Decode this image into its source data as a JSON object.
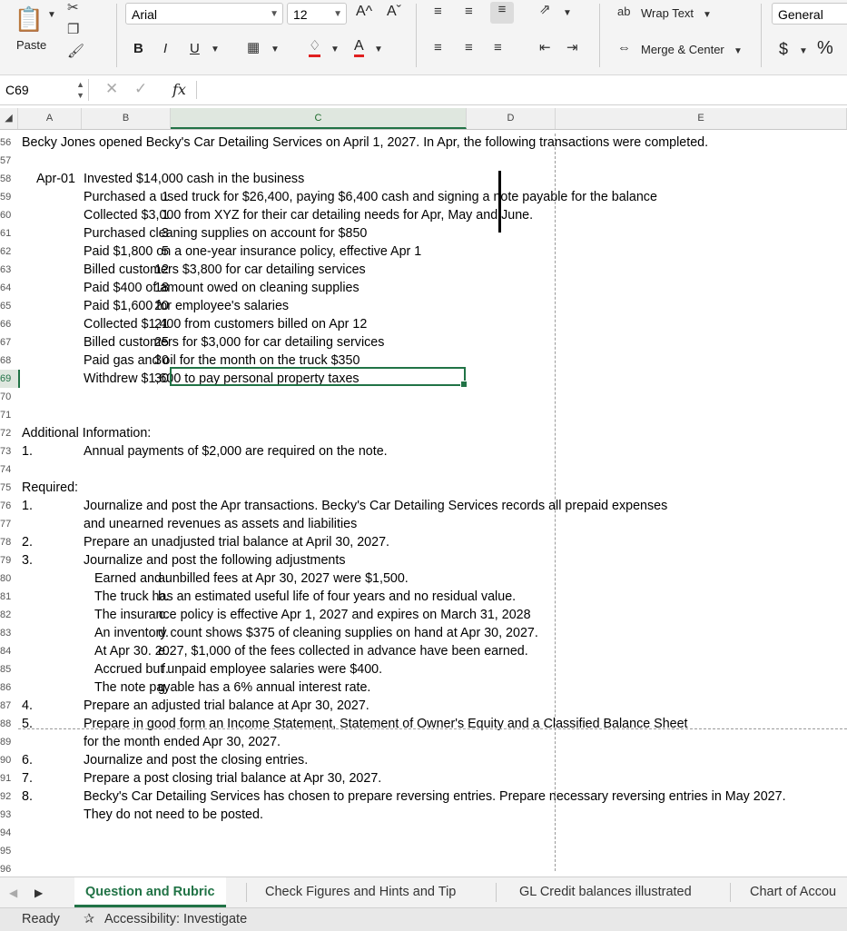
{
  "ribbon": {
    "paste_label": "Paste",
    "font_name": "Arial",
    "font_size": "12",
    "wrap_text_label": "Wrap Text",
    "merge_center_label": "Merge & Center",
    "number_format": "General",
    "currency_symbol": "$",
    "percent_symbol": "%",
    "bold": "B",
    "italic": "I",
    "underline": "U",
    "font_color_letter": "A",
    "grow_font": "A^",
    "shrink_font": "Aˇ"
  },
  "formula_bar": {
    "name_box": "C69",
    "fx": "fx",
    "value": ""
  },
  "columns": [
    "A",
    "B",
    "C",
    "D",
    "E"
  ],
  "selected_column": "C",
  "rows": [
    {
      "n": "56",
      "a": "Becky Jones opened Becky's Car Detailing Services on April 1, 2027.  In Apr, the following transactions were completed.",
      "b": "",
      "c": ""
    },
    {
      "n": "57",
      "a": "",
      "b": "",
      "c": ""
    },
    {
      "n": "58",
      "a": "",
      "b": "Apr-01",
      "c": "Invested $14,000 cash in the business"
    },
    {
      "n": "59",
      "a": "",
      "b": "1",
      "c": "Purchased a used truck for $26,400, paying $6,400 cash and signing a note payable for the balance"
    },
    {
      "n": "60",
      "a": "",
      "b": "1",
      "c": "Collected $3,000 from XYZ for their car detailing needs for Apr, May and June."
    },
    {
      "n": "61",
      "a": "",
      "b": "3",
      "c": "Purchased cleaning supplies on account for $850"
    },
    {
      "n": "62",
      "a": "",
      "b": "5",
      "c": "Paid $1,800 on a one-year insurance policy, effective Apr 1"
    },
    {
      "n": "63",
      "a": "",
      "b": "12",
      "c": "Billed customers $3,800 for car detailing services"
    },
    {
      "n": "64",
      "a": "",
      "b": "18",
      "c": "Paid $400 of amount owed on cleaning supplies"
    },
    {
      "n": "65",
      "a": "",
      "b": "20",
      "c": "Paid $1,600 for employee's salaries"
    },
    {
      "n": "66",
      "a": "",
      "b": "21",
      "c": "Collected $1,400 from customers billed on Apr 12"
    },
    {
      "n": "67",
      "a": "",
      "b": "25",
      "c": "Billed customers for $3,000 for car detailing services"
    },
    {
      "n": "68",
      "a": "",
      "b": "30",
      "c": "Paid gas and oil for the month on the truck $350"
    },
    {
      "n": "69",
      "a": "",
      "b": "30",
      "c": "Withdrew $1,600 to pay personal property taxes"
    },
    {
      "n": "70",
      "a": "",
      "b": "",
      "c": ""
    },
    {
      "n": "71",
      "a": "",
      "b": "",
      "c": ""
    },
    {
      "n": "72",
      "a": "Additional Information:",
      "b": "",
      "c": ""
    },
    {
      "n": "73",
      "a": "1.",
      "b": "",
      "c": " Annual payments of $2,000 are required on the note."
    },
    {
      "n": "74",
      "a": "",
      "b": "",
      "c": ""
    },
    {
      "n": "75",
      "a": "Required:",
      "b": "",
      "c": ""
    },
    {
      "n": "76",
      "a": "1.",
      "b": "",
      "c": "Journalize and post the Apr transactions. Becky's Car Detailing Services records all prepaid expenses"
    },
    {
      "n": "77",
      "a": "",
      "b": "",
      "c": "and unearned revenues as assets and liabilities"
    },
    {
      "n": "78",
      "a": "2.",
      "b": "",
      "c": "Prepare an unadjusted trial balance at April 30, 2027."
    },
    {
      "n": "79",
      "a": "3.",
      "b": "",
      "c": "Journalize and post the following adjustments"
    },
    {
      "n": "80",
      "a": "",
      "b": "a.",
      "c": "Earned and unbilled fees at Apr 30, 2027 were $1,500."
    },
    {
      "n": "81",
      "a": "",
      "b": "b.",
      "c": "The truck has an estimated useful life of four years and no residual value."
    },
    {
      "n": "82",
      "a": "",
      "b": "c.",
      "c": "The insurance policy is effective Apr 1, 2027 and expires on March 31, 2028"
    },
    {
      "n": "83",
      "a": "",
      "b": "d.",
      "c": "An inventory count shows $375 of cleaning supplies on hand at Apr 30, 2027."
    },
    {
      "n": "84",
      "a": "",
      "b": "e.",
      "c": "At Apr 30. 2027, $1,000 of the fees collected in advance have been earned."
    },
    {
      "n": "85",
      "a": "",
      "b": "f.",
      "c": "Accrued but unpaid employee salaries were $400."
    },
    {
      "n": "86",
      "a": "",
      "b": "g.",
      "c": "The note payable has a 6% annual interest rate."
    },
    {
      "n": "87",
      "a": "4.",
      "b": "",
      "c": "Prepare an adjusted trial balance at Apr 30, 2027."
    },
    {
      "n": "88",
      "a": "5.",
      "b": "",
      "c": "Prepare in good form an Income Statement, Statement of Owner's Equity and a Classified Balance Sheet"
    },
    {
      "n": "89",
      "a": "",
      "b": "",
      "c": "for the month ended Apr 30,  2027."
    },
    {
      "n": "90",
      "a": "6.",
      "b": "",
      "c": "Journalize and post the closing entries."
    },
    {
      "n": "91",
      "a": "7.",
      "b": "",
      "c": "Prepare a post closing trial balance at Apr 30, 2027."
    },
    {
      "n": "92",
      "a": "8.",
      "b": "",
      "c": "Becky's Car Detailing Services has chosen to prepare reversing entries. Prepare necessary reversing entries in May 2027."
    },
    {
      "n": "93",
      "a": "",
      "b": "",
      "c": "They do not need to be posted."
    },
    {
      "n": "94",
      "a": "",
      "b": "",
      "c": ""
    },
    {
      "n": "95",
      "a": "",
      "b": "",
      "c": ""
    },
    {
      "n": "96",
      "a": "",
      "b": "",
      "c": ""
    }
  ],
  "selected_row": "69",
  "sheet_tabs": [
    "Question and Rubric",
    "Check Figures and Hints and Tip",
    "GL Credit balances illustrated",
    "Chart of Accou"
  ],
  "active_tab": "Question and Rubric",
  "status": {
    "ready": "Ready",
    "accessibility": "Accessibility: Investigate"
  }
}
